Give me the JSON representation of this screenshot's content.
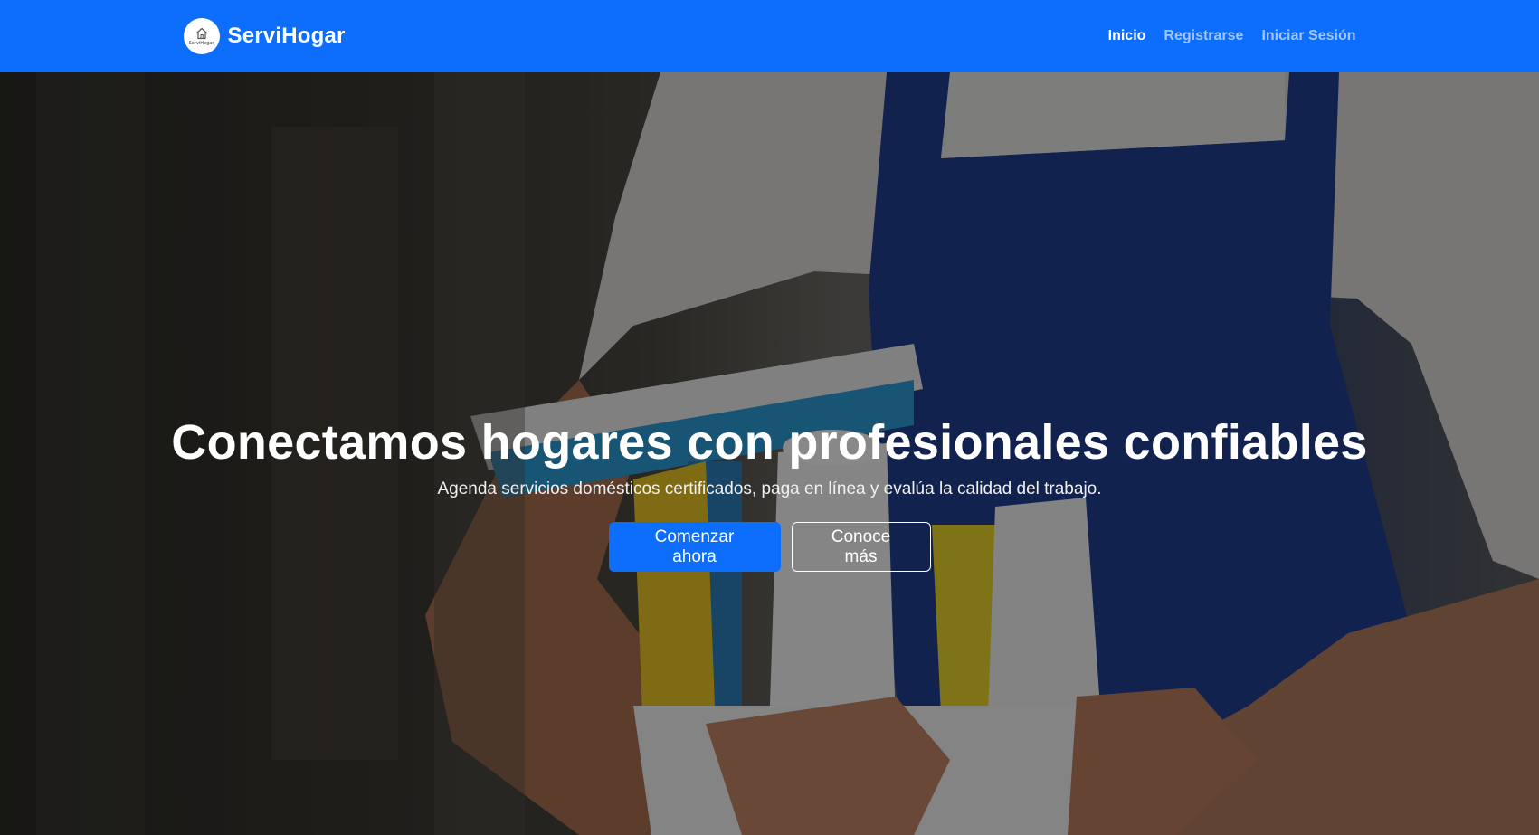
{
  "brand": {
    "name": "ServiHogar",
    "logo_text": "ServiHogar",
    "color": "#0d6efd"
  },
  "nav": {
    "items": [
      {
        "label": "Inicio",
        "active": true
      },
      {
        "label": "Registrarse",
        "active": false
      },
      {
        "label": "Iniciar Sesión",
        "active": false
      }
    ]
  },
  "hero": {
    "title": "Conectamos hogares con profesionales confiables",
    "subtitle": "Agenda servicios domésticos certificados, paga en línea y evalúa la calidad del trabajo.",
    "primary_button": "Comenzar ahora",
    "secondary_button": "Conoce más"
  },
  "icons": {
    "logo": "house-icon"
  }
}
